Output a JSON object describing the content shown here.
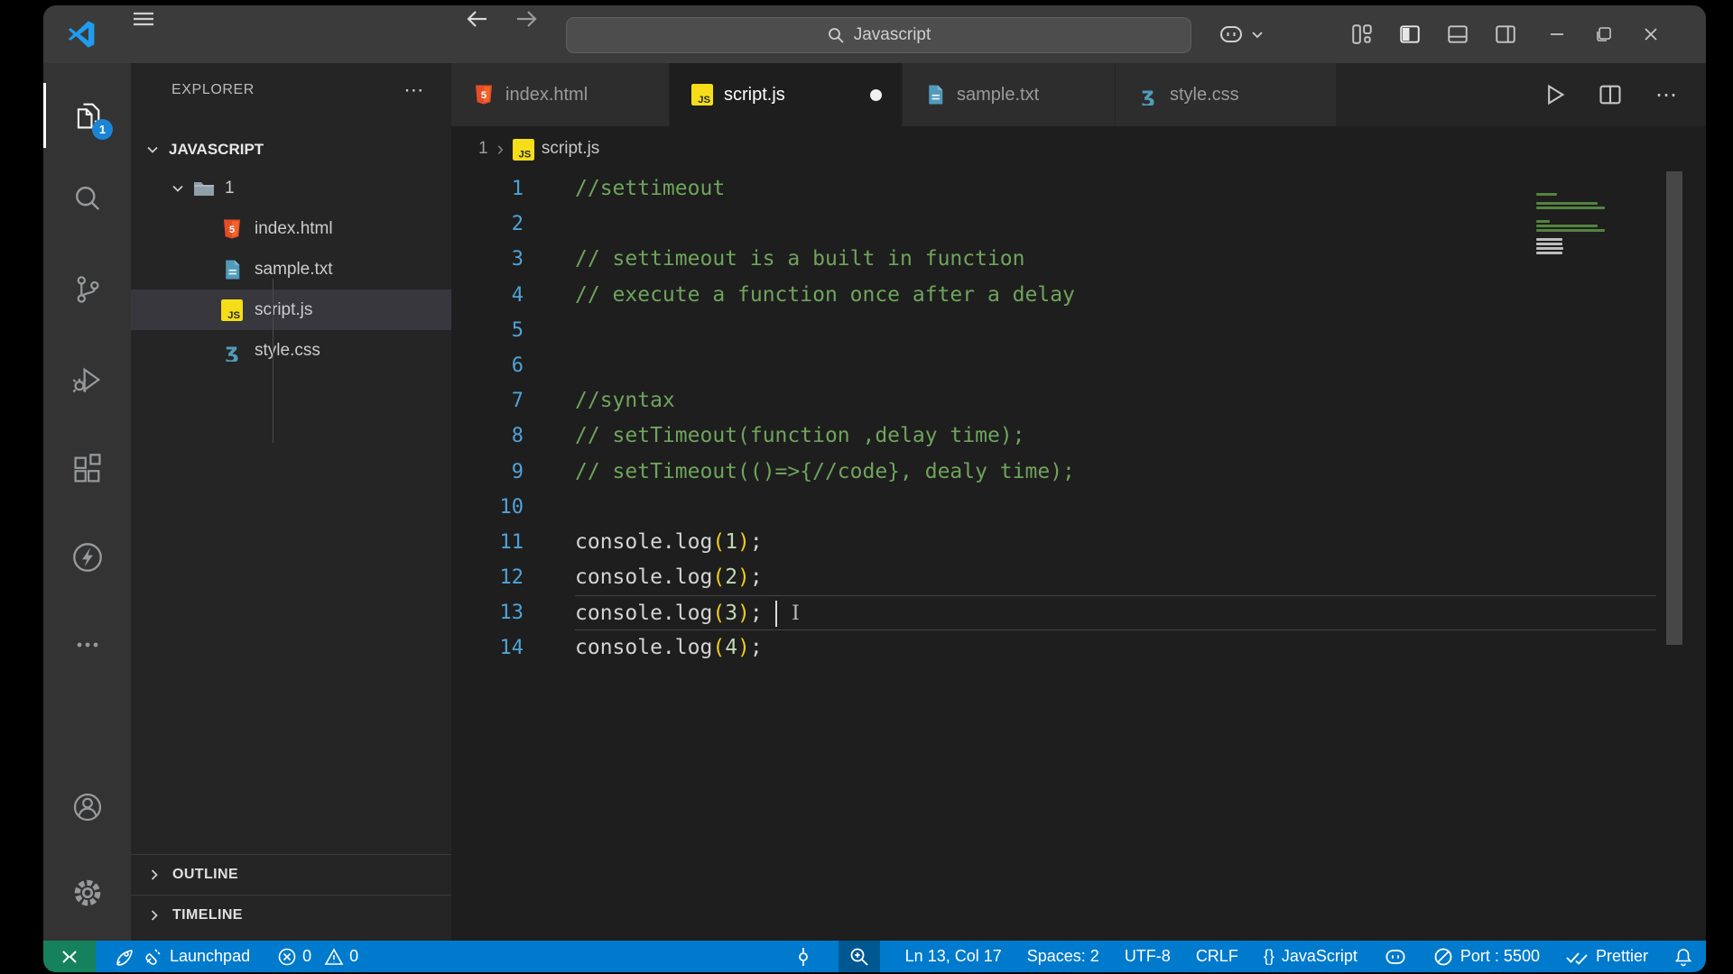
{
  "titlebar": {
    "search_value": "Javascript"
  },
  "glyphs": {
    "ellipsis": "⋯",
    "chevron": "›",
    "ibeam": "I"
  },
  "activity_bar": {
    "explorer_badge": "1"
  },
  "sidebar": {
    "header": "EXPLORER",
    "workspace": "JAVASCRIPT",
    "folder": "1",
    "files": [
      {
        "name": "index.html",
        "icon": "html",
        "selected": false
      },
      {
        "name": "sample.txt",
        "icon": "txt",
        "selected": false
      },
      {
        "name": "script.js",
        "icon": "js",
        "selected": true
      },
      {
        "name": "style.css",
        "icon": "css",
        "selected": false
      }
    ],
    "outline": "OUTLINE",
    "timeline": "TIMELINE"
  },
  "tabs": [
    {
      "label": "index.html",
      "icon": "html",
      "active": false,
      "dirty": false
    },
    {
      "label": "script.js",
      "icon": "js",
      "active": true,
      "dirty": true
    },
    {
      "label": "sample.txt",
      "icon": "txt",
      "active": false,
      "dirty": false
    },
    {
      "label": "style.css",
      "icon": "css",
      "active": false,
      "dirty": false
    }
  ],
  "breadcrumb": {
    "folder": "1",
    "file": "script.js"
  },
  "editor": {
    "cursor_line": 13,
    "lines": [
      {
        "num": 1,
        "segments": [
          {
            "t": "//settimeout",
            "c": "com"
          }
        ]
      },
      {
        "num": 2,
        "segments": []
      },
      {
        "num": 3,
        "segments": [
          {
            "t": "// settimeout is a built in function",
            "c": "com"
          }
        ]
      },
      {
        "num": 4,
        "segments": [
          {
            "t": "// execute a function once after a delay",
            "c": "com"
          }
        ]
      },
      {
        "num": 5,
        "segments": []
      },
      {
        "num": 6,
        "segments": []
      },
      {
        "num": 7,
        "segments": [
          {
            "t": "//syntax",
            "c": "com"
          }
        ]
      },
      {
        "num": 8,
        "segments": [
          {
            "t": "// setTimeout(function ,delay time);",
            "c": "com"
          }
        ]
      },
      {
        "num": 9,
        "segments": [
          {
            "t": "// setTimeout(()=>{//code}, dealy time);",
            "c": "com"
          }
        ]
      },
      {
        "num": 10,
        "segments": []
      },
      {
        "num": 11,
        "segments": [
          {
            "t": "console.log",
            "c": "fg"
          },
          {
            "t": "(",
            "c": "paren"
          },
          {
            "t": "1",
            "c": "num"
          },
          {
            "t": ")",
            "c": "paren"
          },
          {
            "t": ";",
            "c": "fg"
          }
        ]
      },
      {
        "num": 12,
        "segments": [
          {
            "t": "console.log",
            "c": "fg"
          },
          {
            "t": "(",
            "c": "paren"
          },
          {
            "t": "2",
            "c": "num"
          },
          {
            "t": ")",
            "c": "paren"
          },
          {
            "t": ";",
            "c": "fg"
          }
        ]
      },
      {
        "num": 13,
        "segments": [
          {
            "t": "console.log",
            "c": "fg"
          },
          {
            "t": "(",
            "c": "paren"
          },
          {
            "t": "3",
            "c": "num"
          },
          {
            "t": ")",
            "c": "paren"
          },
          {
            "t": "; ",
            "c": "fg"
          }
        ]
      },
      {
        "num": 14,
        "segments": [
          {
            "t": "console.log",
            "c": "fg"
          },
          {
            "t": "(",
            "c": "paren"
          },
          {
            "t": "4",
            "c": "num"
          },
          {
            "t": ")",
            "c": "paren"
          },
          {
            "t": ";",
            "c": "fg"
          }
        ]
      }
    ]
  },
  "status_bar": {
    "launchpad": "Launchpad",
    "errors": "0",
    "warnings": "0",
    "line_col": "Ln 13, Col 17",
    "spaces": "Spaces: 2",
    "encoding": "UTF-8",
    "eol": "CRLF",
    "braces": "{}",
    "language": "JavaScript",
    "port": "Port : 5500",
    "prettier": "Prettier"
  },
  "colors": {
    "statusbar": "#007acc",
    "remote": "#16825d",
    "badge": "#1a85d6",
    "editor_bg": "#1e1e1e"
  }
}
